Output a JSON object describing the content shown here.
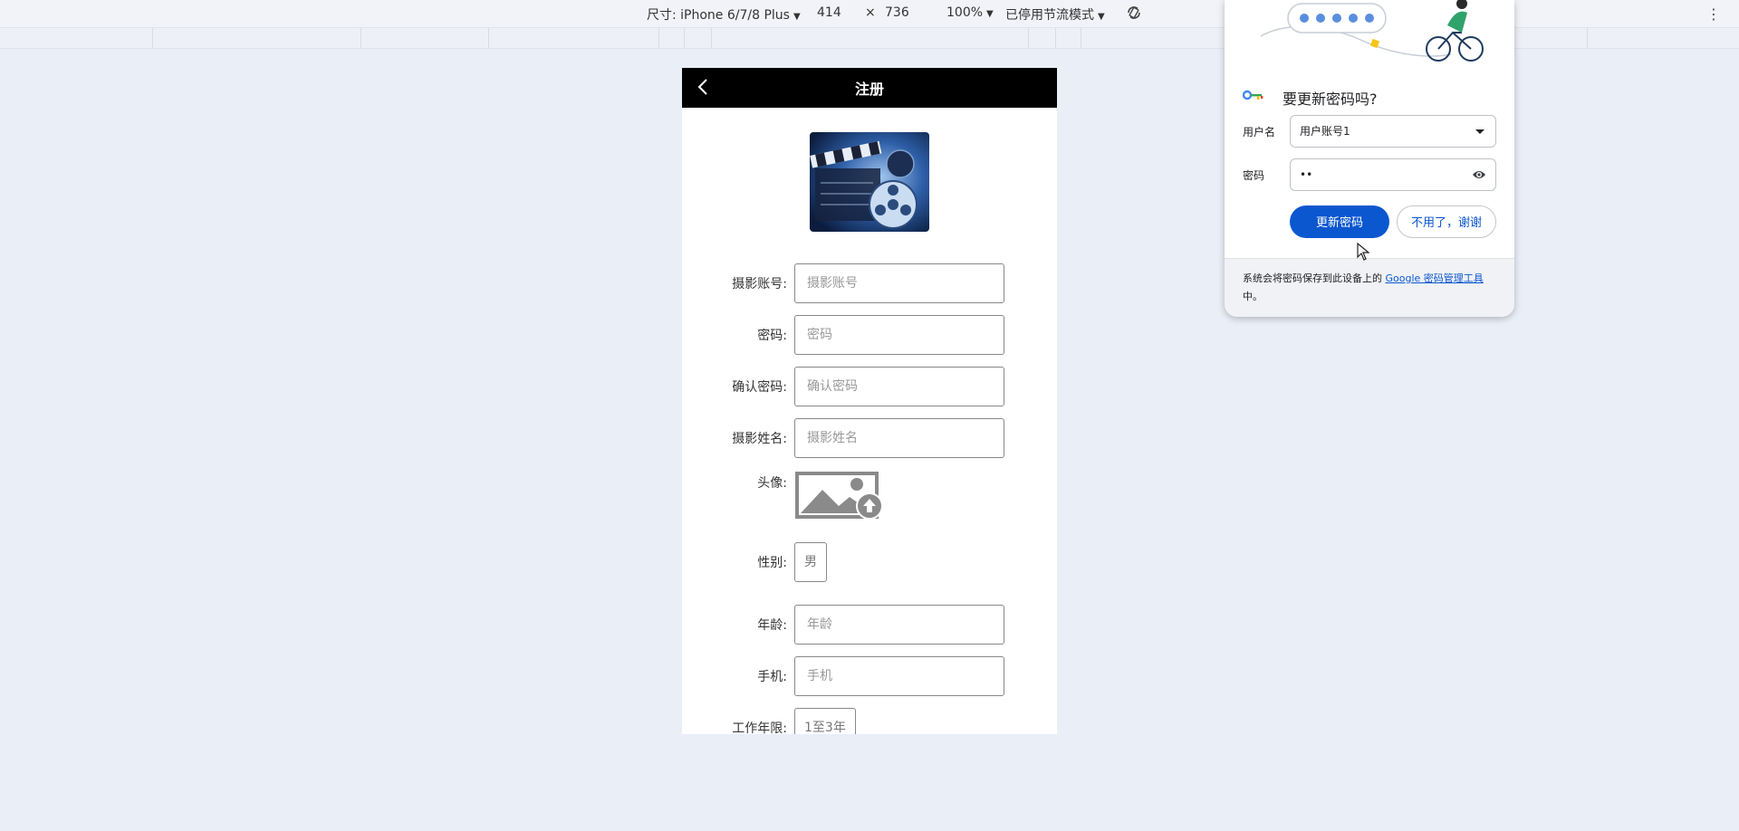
{
  "devtools": {
    "device_label": "尺寸: iPhone 6/7/8 Plus",
    "width": "414",
    "times": "×",
    "height": "736",
    "zoom": "100%",
    "throttle": "已停用节流模式"
  },
  "phone": {
    "nav_title": "注册",
    "fields": [
      {
        "label": "摄影账号:",
        "placeholder": "摄影账号"
      },
      {
        "label": "密码:",
        "placeholder": "密码"
      },
      {
        "label": "确认密码:",
        "placeholder": "确认密码"
      },
      {
        "label": "摄影姓名:",
        "placeholder": "摄影姓名"
      }
    ],
    "avatar_label": "头像:",
    "gender_label": "性别:",
    "gender_value": "男",
    "age": {
      "label": "年龄:",
      "placeholder": "年龄"
    },
    "phone_field": {
      "label": "手机:",
      "placeholder": "手机"
    },
    "work_years_label": "工作年限:",
    "work_years_value": "1至3年"
  },
  "popup": {
    "heading": "要更新密码吗?",
    "username_label": "用户名",
    "username_value": "用户账号1",
    "password_label": "密码",
    "password_value": "••",
    "update_button": "更新密码",
    "decline_button": "不用了，谢谢",
    "footer_text": "系统会将密码保存到此设备上的",
    "footer_link": "Google 密码管理工具",
    "footer_suffix": "中。"
  },
  "colors": {
    "primary_button": "#0b57d0",
    "nav_bar": "#000000",
    "page_bg": "#eaeef7"
  }
}
